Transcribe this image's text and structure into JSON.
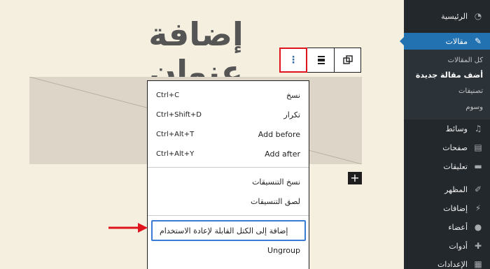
{
  "editor": {
    "post_title": "إضافة عنوان",
    "add_block_symbol": "+"
  },
  "toolbar": {
    "more_symbol": "⋮",
    "align_symbol": "≡",
    "transform_symbol": "⧉"
  },
  "menu": {
    "items": [
      {
        "label": "نسخ",
        "shortcut": "Ctrl+C"
      },
      {
        "label": "تكرار",
        "shortcut": "Ctrl+Shift+D"
      },
      {
        "label": "Add before",
        "shortcut": "Ctrl+Alt+T"
      },
      {
        "label": "Add after",
        "shortcut": "Ctrl+Alt+Y"
      }
    ],
    "copy_styles": "نسخ التنسيقات",
    "paste_styles": "لصق التنسيقات",
    "add_reusable": "إضافة إلى الكتل القابلة لإعادة الاستخدام",
    "ungroup": "Ungroup"
  },
  "sidebar": {
    "home": "الرئيسية",
    "posts": "مقالات",
    "posts_sub": [
      "كل المقالات",
      "أضف مقالة جديدة",
      "تصنيفات",
      "وسوم"
    ],
    "media": "وسائط",
    "pages": "صفحات",
    "comments": "تعليقات",
    "appearance": "المظهر",
    "plugins": "إضافات",
    "users": "أعضاء",
    "tools": "أدوات",
    "settings": "الإعدادات"
  },
  "colors": {
    "accent": "#2271b1",
    "highlight": "#e0141c",
    "sidebar_bg": "#23282d",
    "editor_bg": "#f5efe0"
  }
}
